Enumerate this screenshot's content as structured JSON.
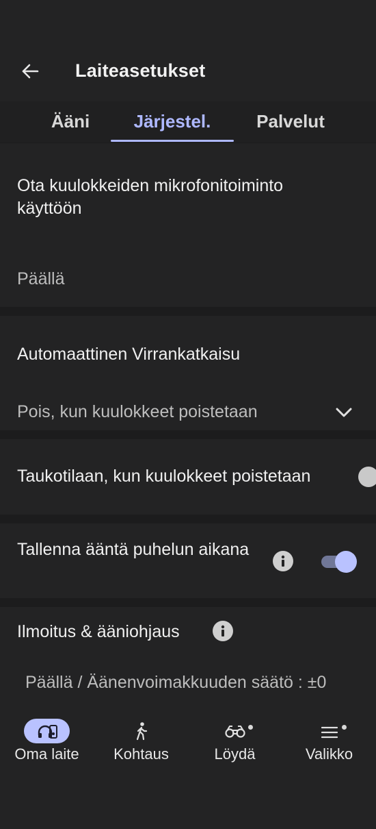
{
  "header": {
    "title": "Laiteasetukset"
  },
  "tabs": [
    {
      "label": "Ääni",
      "active": false
    },
    {
      "label": "Järjestel.",
      "active": true
    },
    {
      "label": "Palvelut",
      "active": false
    }
  ],
  "settings": {
    "mic": {
      "title": "Ota kuulokkeiden mikrofonitoiminto käyttöön",
      "value": "Päällä"
    },
    "auto_power_off": {
      "title": "Automaattinen Virrankatkaisu",
      "value": "Pois, kun kuulokkeet poistetaan"
    },
    "pause": {
      "title": "Taukotilaan, kun kuulokkeet poistetaan",
      "enabled": false
    },
    "record_during_call": {
      "title": "Tallenna ääntä puhelun aikana",
      "enabled": true
    },
    "notification": {
      "title": "Ilmoitus & ääniohjaus",
      "value": "Päällä / Äänenvoimakkuuden säätö : ±0"
    }
  },
  "bottom_nav": [
    {
      "label": "Oma laite",
      "icon": "headphones-device-icon",
      "active": true
    },
    {
      "label": "Kohtaus",
      "icon": "walking-person-icon",
      "active": false
    },
    {
      "label": "Löydä",
      "icon": "binoculars-icon",
      "active": false,
      "badge": true
    },
    {
      "label": "Valikko",
      "icon": "menu-icon",
      "active": false,
      "badge": true
    }
  ],
  "colors": {
    "accent": "#aeb8ff",
    "background": "#1c1c1d",
    "card": "#232324"
  }
}
